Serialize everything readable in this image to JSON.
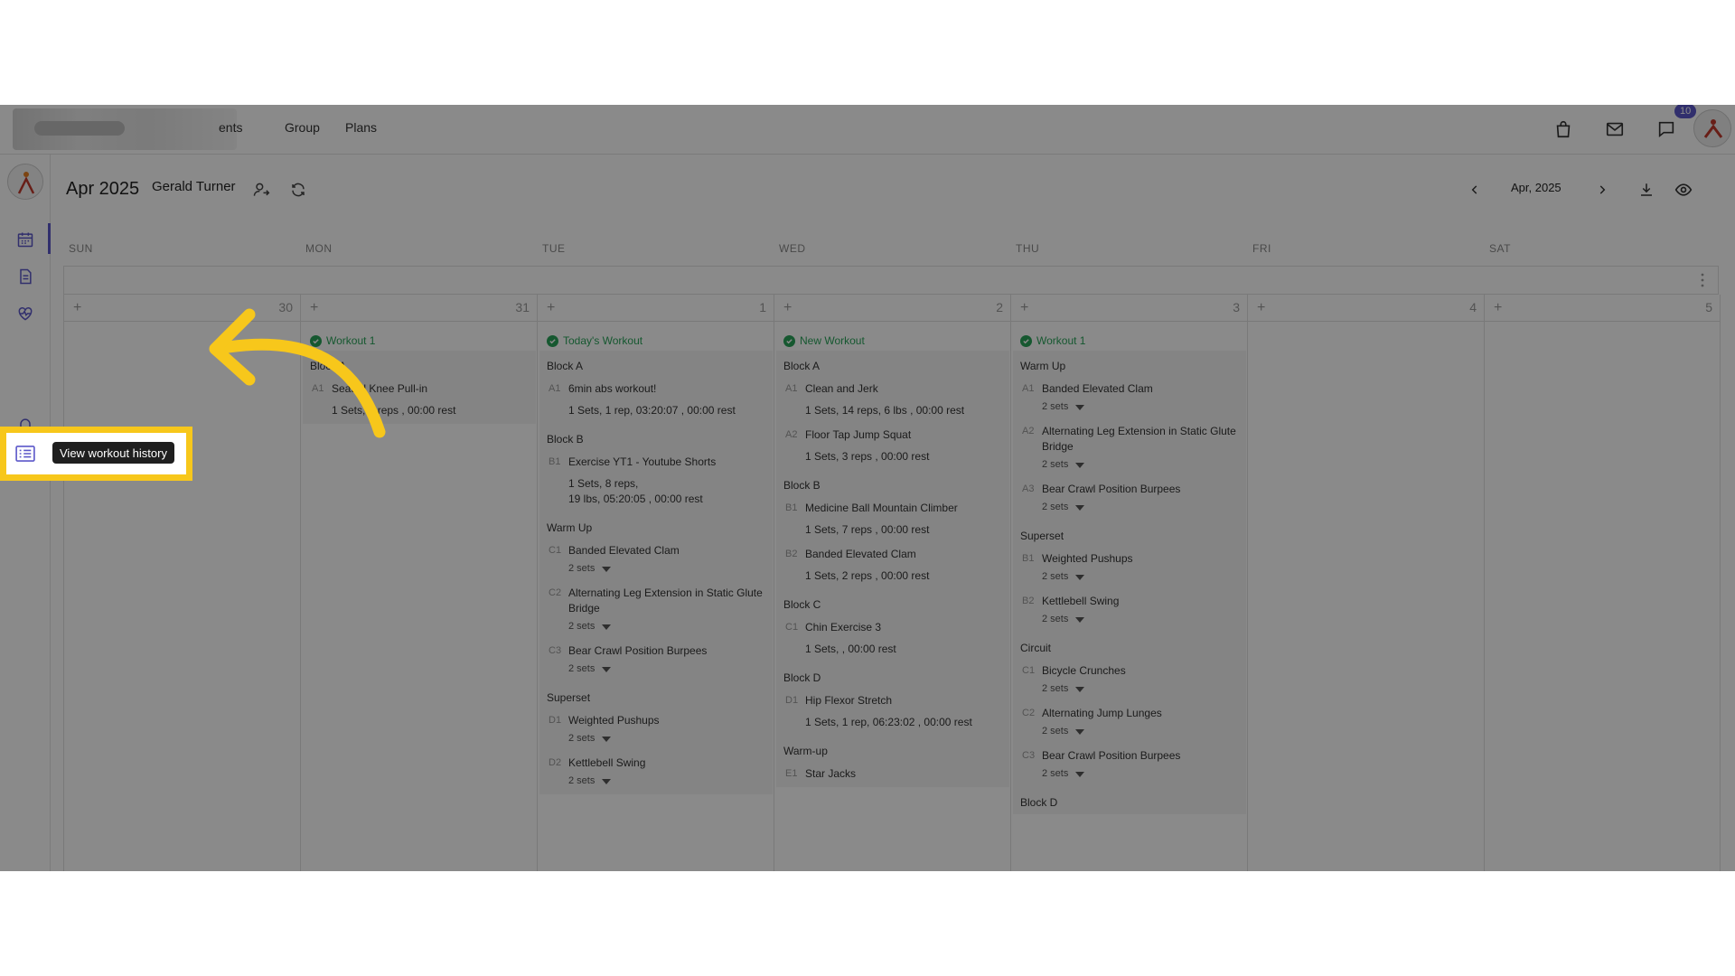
{
  "nav": {
    "links": [
      "ents",
      "Group",
      "Plans"
    ],
    "badge": "10"
  },
  "header": {
    "month": "Apr 2025",
    "client_name": "Gerald Turner",
    "nav_month": "Apr, 2025"
  },
  "weekdays": [
    "SUN",
    "MON",
    "TUE",
    "WED",
    "THU",
    "FRI",
    "SAT"
  ],
  "day_numbers": [
    "30",
    "31",
    "1",
    "2",
    "3",
    "4",
    "5"
  ],
  "tooltip": "View workout history",
  "colors": {
    "accent": "#5b57c9",
    "success": "#2aa35a",
    "highlight": "#f7c71b"
  },
  "days": {
    "mon": {
      "title": "Workout 1",
      "groups": [
        {
          "label": "Block A",
          "exercises": [
            {
              "code": "A1",
              "name": "Seated Knee Pull-in",
              "detail": "1 Sets, 2 reps , 00:00 rest"
            }
          ]
        }
      ]
    },
    "tue": {
      "title": "Today's Workout",
      "groups": [
        {
          "label": "Block A",
          "exercises": [
            {
              "code": "A1",
              "name": "6min abs workout!",
              "detail": "1 Sets, 1 rep, 03:20:07 , 00:00 rest"
            }
          ]
        },
        {
          "label": "Block B",
          "exercises": [
            {
              "code": "B1",
              "name": "Exercise YT1 - Youtube Shorts",
              "detail": "1 Sets, 8 reps,",
              "detail2": "19 lbs, 05:20:05 , 00:00 rest"
            }
          ]
        },
        {
          "label": "Warm Up",
          "exercises": [
            {
              "code": "C1",
              "name": "Banded Elevated Clam",
              "sets": "2 sets"
            },
            {
              "code": "C2",
              "name": "Alternating Leg Extension in Static Glute Bridge",
              "sets": "2 sets"
            },
            {
              "code": "C3",
              "name": "Bear Crawl Position Burpees",
              "sets": "2 sets"
            }
          ]
        },
        {
          "label": "Superset",
          "exercises": [
            {
              "code": "D1",
              "name": "Weighted Pushups",
              "sets": "2 sets"
            },
            {
              "code": "D2",
              "name": "Kettlebell Swing",
              "sets": "2 sets"
            }
          ]
        }
      ]
    },
    "wed": {
      "title": "New Workout",
      "groups": [
        {
          "label": "Block A",
          "exercises": [
            {
              "code": "A1",
              "name": "Clean and Jerk",
              "detail": "1 Sets, 14 reps, 6 lbs , 00:00 rest"
            },
            {
              "code": "A2",
              "name": "Floor Tap Jump Squat",
              "detail": "1 Sets, 3 reps , 00:00 rest"
            }
          ]
        },
        {
          "label": "Block B",
          "exercises": [
            {
              "code": "B1",
              "name": "Medicine Ball Mountain Climber",
              "detail": "1 Sets, 7 reps , 00:00 rest"
            },
            {
              "code": "B2",
              "name": "Banded Elevated Clam",
              "detail": "1 Sets, 2 reps , 00:00 rest"
            }
          ]
        },
        {
          "label": "Block C",
          "exercises": [
            {
              "code": "C1",
              "name": "Chin Exercise 3",
              "detail": "1 Sets, , 00:00 rest"
            }
          ]
        },
        {
          "label": "Block D",
          "exercises": [
            {
              "code": "D1",
              "name": "Hip Flexor Stretch",
              "detail": "1 Sets, 1 rep, 06:23:02 , 00:00 rest"
            }
          ]
        },
        {
          "label": "Warm-up",
          "exercises": [
            {
              "code": "E1",
              "name": "Star Jacks"
            }
          ]
        }
      ]
    },
    "thu": {
      "title": "Workout 1",
      "groups": [
        {
          "label": "Warm Up",
          "exercises": [
            {
              "code": "A1",
              "name": "Banded Elevated Clam",
              "sets": "2 sets"
            },
            {
              "code": "A2",
              "name": "Alternating Leg Extension in Static Glute Bridge",
              "sets": "2 sets"
            },
            {
              "code": "A3",
              "name": "Bear Crawl Position Burpees",
              "sets": "2 sets"
            }
          ]
        },
        {
          "label": "Superset",
          "exercises": [
            {
              "code": "B1",
              "name": "Weighted Pushups",
              "sets": "2 sets"
            },
            {
              "code": "B2",
              "name": "Kettlebell Swing",
              "sets": "2 sets"
            }
          ]
        },
        {
          "label": "Circuit",
          "exercises": [
            {
              "code": "C1",
              "name": "Bicycle Crunches",
              "sets": "2 sets"
            },
            {
              "code": "C2",
              "name": "Alternating Jump Lunges",
              "sets": "2 sets"
            },
            {
              "code": "C3",
              "name": "Bear Crawl Position Burpees",
              "sets": "2 sets"
            }
          ]
        },
        {
          "label": "Block D",
          "exercises": []
        }
      ]
    }
  }
}
